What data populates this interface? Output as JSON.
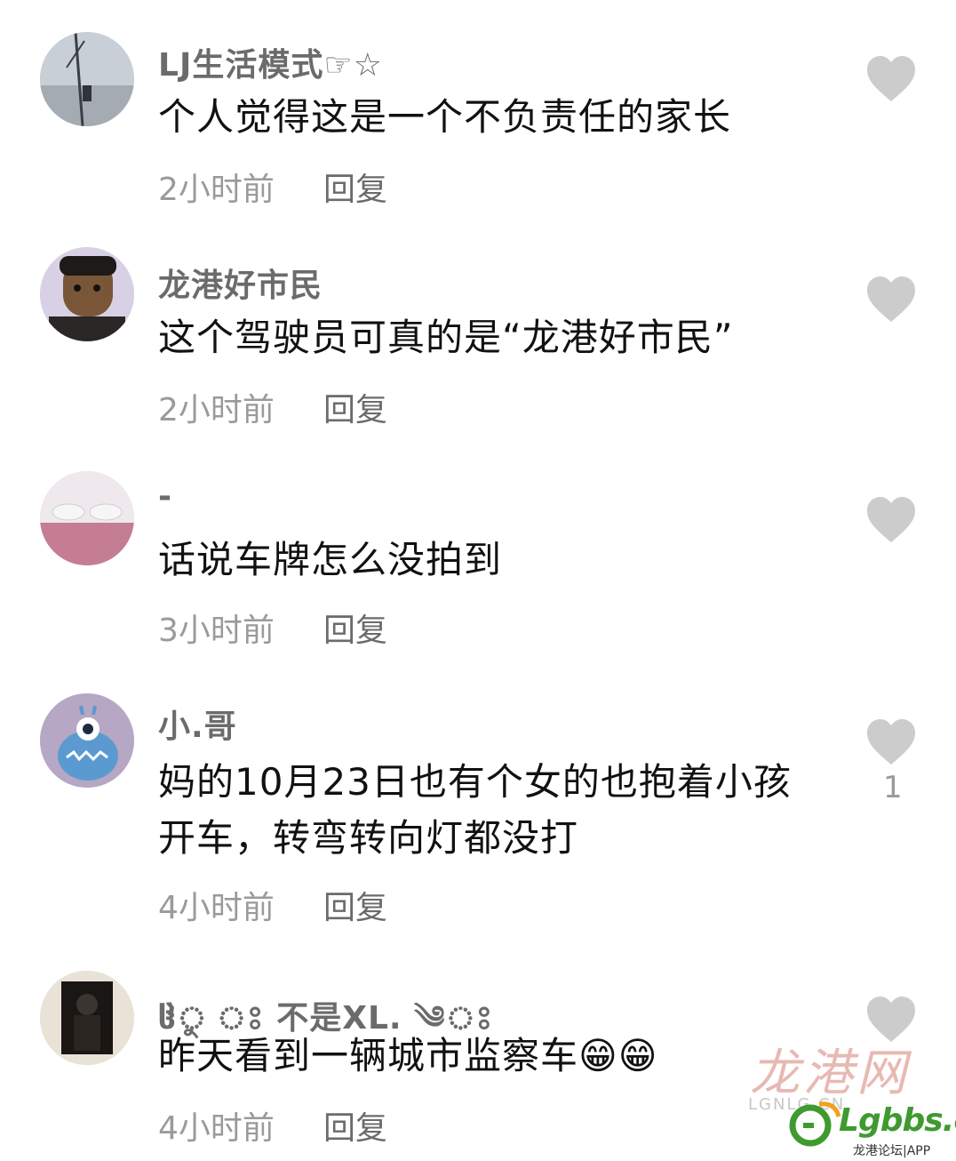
{
  "comments": [
    {
      "username": "LJ生活模式☞☆",
      "text": "个人觉得这是一个不负责任的家长",
      "time": "2小时前",
      "reply": "回复",
      "avatar_icon": "cable-car-photo-avatar",
      "likes": ""
    },
    {
      "username": "龙港好市民",
      "text": "这个驾驶员可真的是“龙港好市民”",
      "time": "2小时前",
      "reply": "回复",
      "avatar_icon": "cartoon-face-avatar",
      "likes": ""
    },
    {
      "username": "-",
      "text": "话说车牌怎么没拍到",
      "time": "3小时前",
      "reply": "回复",
      "avatar_icon": "pink-photo-avatar",
      "likes": ""
    },
    {
      "username": "小.哥",
      "text": "妈的10月23日也有个女的也抱着小孩开车，转弯转向灯都没打",
      "time": "4小时前",
      "reply": "回复",
      "avatar_icon": "blue-monster-avatar",
      "likes": "1"
    },
    {
      "username": "ჱ̒ু ঃ 不是XL. ༄ঃ",
      "text": "昨天看到一辆城市监察车😁😁",
      "time": "4小时前",
      "reply": "回复",
      "avatar_icon": "dark-figure-photo-avatar",
      "likes": ""
    }
  ],
  "watermark": {
    "site_cn": "龙港网",
    "site_url": "LGNLG.CN",
    "brand": "Lgbbs.cn",
    "app_label": "龙港论坛|APP"
  },
  "colors": {
    "username": "#6b6b6b",
    "text": "#111111",
    "time": "#9a9a9a",
    "heart": "#cccccc",
    "brand_green": "#3f9a2f"
  }
}
